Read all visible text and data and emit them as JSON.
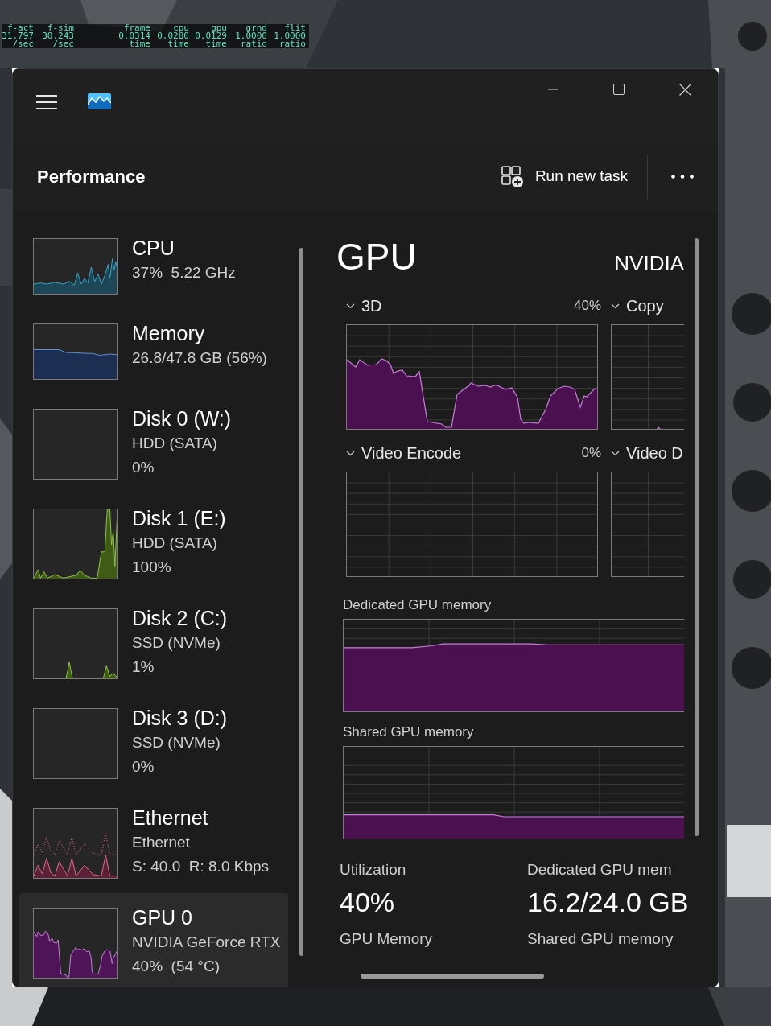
{
  "hud": {
    "columns": [
      {
        "label": "f-act",
        "value": "31.797",
        "unit": "/sec"
      },
      {
        "label": "f-sim",
        "value": "30.243",
        "unit": "/sec"
      },
      {
        "label": "frame",
        "value": "0.0314",
        "unit": "time"
      },
      {
        "label": "cpu",
        "value": "0.0280",
        "unit": "time"
      },
      {
        "label": "gpu",
        "value": "0.0129",
        "unit": "time"
      },
      {
        "label": "grnd",
        "value": "1.0000",
        "unit": "ratio"
      },
      {
        "label": "flit",
        "value": "1.0000",
        "unit": "ratio"
      }
    ]
  },
  "header": {
    "title": "Performance",
    "action": "Run new task"
  },
  "sidebar": {
    "items": [
      {
        "kind": "cpu",
        "title": "CPU",
        "lines": [
          "37%  5.22 GHz"
        ],
        "selected": false
      },
      {
        "kind": "memory",
        "title": "Memory",
        "lines": [
          "26.8/47.8 GB (56%)"
        ],
        "selected": false
      },
      {
        "kind": "disk",
        "title": "Disk 0 (W:)",
        "lines": [
          "HDD (SATA)",
          "0%"
        ],
        "selected": false
      },
      {
        "kind": "disk",
        "title": "Disk 1 (E:)",
        "lines": [
          "HDD (SATA)",
          "100%"
        ],
        "selected": false
      },
      {
        "kind": "disk",
        "title": "Disk 2 (C:)",
        "lines": [
          "SSD (NVMe)",
          "1%"
        ],
        "selected": false
      },
      {
        "kind": "disk",
        "title": "Disk 3 (D:)",
        "lines": [
          "SSD (NVMe)",
          "0%"
        ],
        "selected": false
      },
      {
        "kind": "ethernet",
        "title": "Ethernet",
        "lines": [
          "Ethernet",
          "S: 40.0  R: 8.0 Kbps"
        ],
        "selected": false
      },
      {
        "kind": "gpu",
        "title": "GPU 0",
        "lines": [
          "NVIDIA GeForce RTX",
          "40%  (54 °C)"
        ],
        "selected": true
      }
    ]
  },
  "detail": {
    "title": "GPU",
    "vendor": "NVIDIA",
    "engines": [
      {
        "label": "3D",
        "value": "40%"
      },
      {
        "label": "Copy"
      },
      {
        "label": "Video Encode",
        "value": "0%"
      },
      {
        "label": "Video D"
      }
    ],
    "memory_charts": [
      "Dedicated GPU memory",
      "Shared GPU memory"
    ],
    "stats": [
      {
        "label": "Utilization",
        "value": "40%"
      },
      {
        "label": "Dedicated GPU mem",
        "value": "16.2/24.0 GB"
      },
      {
        "label": "GPU Memory"
      },
      {
        "label": "Shared GPU memory"
      }
    ]
  }
}
